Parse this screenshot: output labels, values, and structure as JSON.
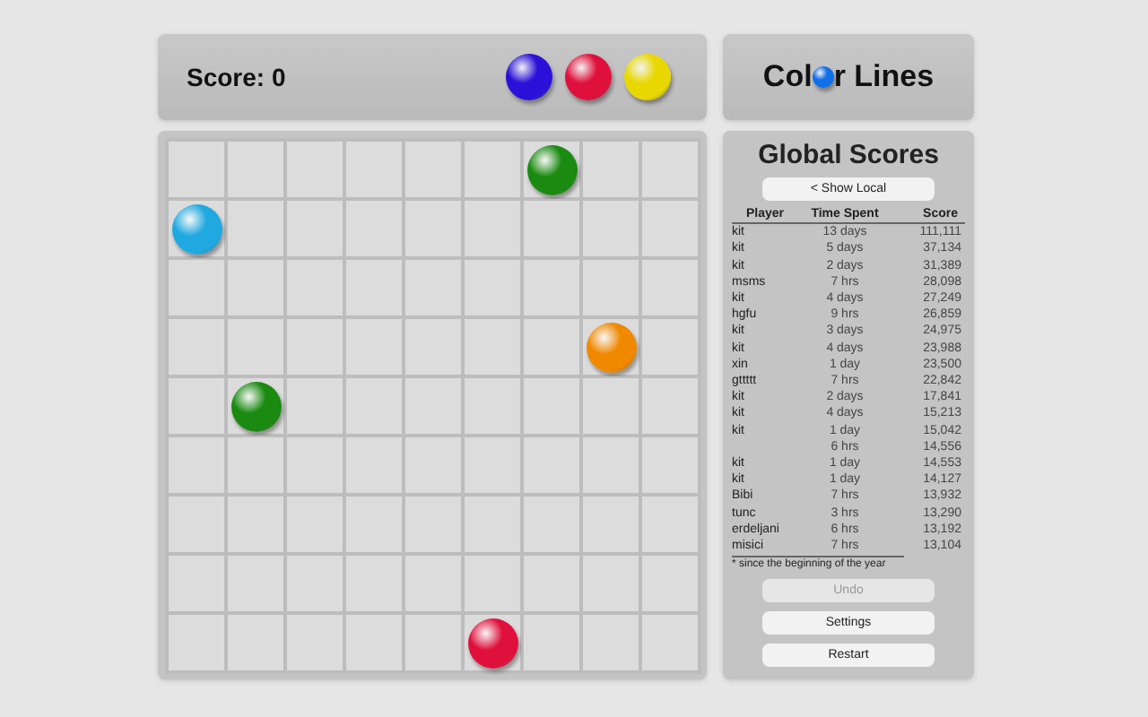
{
  "score_label": "Score: 0",
  "next_balls": [
    {
      "color": "#2a10d8"
    },
    {
      "color": "#e0103c"
    },
    {
      "color": "#e8d800"
    }
  ],
  "logo": {
    "before": "Col",
    "after": "r Lines"
  },
  "board": {
    "rows": [
      {
        "cells": [
          {
            "ball": false
          },
          {
            "ball": false
          },
          {
            "ball": false
          },
          {
            "ball": false
          },
          {
            "ball": false
          },
          {
            "ball": false
          },
          {
            "ball": true,
            "color": "#1a8a10"
          },
          {
            "ball": false
          },
          {
            "ball": false
          }
        ]
      },
      {
        "cells": [
          {
            "ball": true,
            "color": "#20a8e0"
          },
          {
            "ball": false
          },
          {
            "ball": false
          },
          {
            "ball": false
          },
          {
            "ball": false
          },
          {
            "ball": false
          },
          {
            "ball": false
          },
          {
            "ball": false
          },
          {
            "ball": false
          }
        ]
      },
      {
        "cells": [
          {
            "ball": false
          },
          {
            "ball": false
          },
          {
            "ball": false
          },
          {
            "ball": false
          },
          {
            "ball": false
          },
          {
            "ball": false
          },
          {
            "ball": false
          },
          {
            "ball": false
          },
          {
            "ball": false
          }
        ]
      },
      {
        "cells": [
          {
            "ball": false
          },
          {
            "ball": false
          },
          {
            "ball": false
          },
          {
            "ball": false
          },
          {
            "ball": false
          },
          {
            "ball": false
          },
          {
            "ball": false
          },
          {
            "ball": true,
            "color": "#f08800"
          },
          {
            "ball": false
          }
        ]
      },
      {
        "cells": [
          {
            "ball": false
          },
          {
            "ball": true,
            "color": "#1a8a10"
          },
          {
            "ball": false
          },
          {
            "ball": false
          },
          {
            "ball": false
          },
          {
            "ball": false
          },
          {
            "ball": false
          },
          {
            "ball": false
          },
          {
            "ball": false
          }
        ]
      },
      {
        "cells": [
          {
            "ball": false
          },
          {
            "ball": false
          },
          {
            "ball": false
          },
          {
            "ball": false
          },
          {
            "ball": false
          },
          {
            "ball": false
          },
          {
            "ball": false
          },
          {
            "ball": false
          },
          {
            "ball": false
          }
        ]
      },
      {
        "cells": [
          {
            "ball": false
          },
          {
            "ball": false
          },
          {
            "ball": false
          },
          {
            "ball": false
          },
          {
            "ball": false
          },
          {
            "ball": false
          },
          {
            "ball": false
          },
          {
            "ball": false
          },
          {
            "ball": false
          }
        ]
      },
      {
        "cells": [
          {
            "ball": false
          },
          {
            "ball": false
          },
          {
            "ball": false
          },
          {
            "ball": false
          },
          {
            "ball": false
          },
          {
            "ball": false
          },
          {
            "ball": false
          },
          {
            "ball": false
          },
          {
            "ball": false
          }
        ]
      },
      {
        "cells": [
          {
            "ball": false
          },
          {
            "ball": false
          },
          {
            "ball": false
          },
          {
            "ball": false
          },
          {
            "ball": false
          },
          {
            "ball": true,
            "color": "#e0103c"
          },
          {
            "ball": false
          },
          {
            "ball": false
          },
          {
            "ball": false
          }
        ]
      }
    ]
  },
  "scores": {
    "title": "Global Scores",
    "toggle": "< Show Local",
    "columns": [
      "Player",
      "Time Spent",
      "Score"
    ],
    "rows": [
      [
        "kit",
        "13 days",
        "111,111"
      ],
      [
        "kit",
        "5 days",
        "37,134"
      ],
      [
        "kit",
        "2 days",
        "31,389"
      ],
      [
        "msms",
        "7 hrs",
        "28,098"
      ],
      [
        "kit",
        "4 days",
        "27,249"
      ],
      [
        "hgfu",
        "9 hrs",
        "26,859"
      ],
      [
        "kit",
        "3 days",
        "24,975"
      ],
      [
        "kit",
        "4 days",
        "23,988"
      ],
      [
        "xin",
        "1 day",
        "23,500"
      ],
      [
        "gttttt",
        "7 hrs",
        "22,842"
      ],
      [
        "kit",
        "2 days",
        "17,841"
      ],
      [
        "kit",
        "4 days",
        "15,213"
      ],
      [
        "kit",
        "1 day",
        "15,042"
      ],
      [
        "",
        "6 hrs",
        "14,556"
      ],
      [
        "kit",
        "1 day",
        "14,553"
      ],
      [
        "kit",
        "1 day",
        "14,127"
      ],
      [
        "Bibi",
        "7 hrs",
        "13,932"
      ],
      [
        "tunc",
        "3 hrs",
        "13,290"
      ],
      [
        "erdeljani",
        "6 hrs",
        "13,192"
      ],
      [
        "misici",
        "7 hrs",
        "13,104"
      ]
    ],
    "footnote": "* since the beginning of the year"
  },
  "buttons": [
    {
      "label": "Undo",
      "disabled": true
    },
    {
      "label": "Settings",
      "disabled": false
    },
    {
      "label": "Restart",
      "disabled": false
    }
  ]
}
